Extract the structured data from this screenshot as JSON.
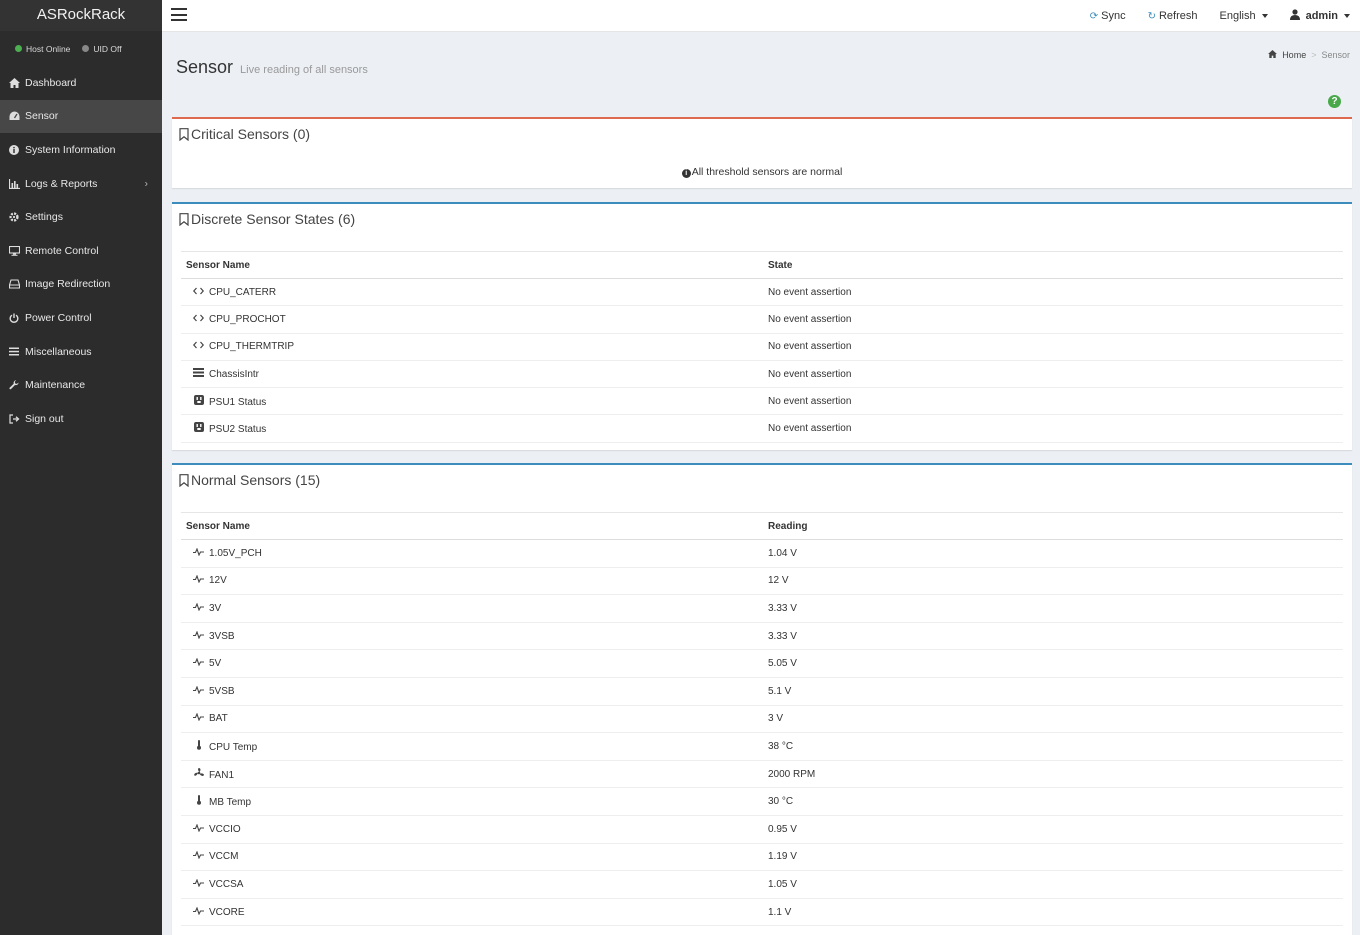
{
  "sidebar": {
    "brand": "ASRockRack",
    "status": [
      {
        "label": "Host Online",
        "color": "#4caf50"
      },
      {
        "label": "UID Off",
        "color": "#888888"
      }
    ],
    "items": [
      {
        "label": "Dashboard",
        "icon": "home-icon"
      },
      {
        "label": "Sensor",
        "icon": "dashboard-icon",
        "active": true
      },
      {
        "label": "System Information",
        "icon": "info-circle-icon"
      },
      {
        "label": "Logs & Reports",
        "icon": "bar-chart-icon"
      },
      {
        "label": "Settings",
        "icon": "gear-icon"
      },
      {
        "label": "Remote Control",
        "icon": "desktop-icon"
      },
      {
        "label": "Image Redirection",
        "icon": "hdd-icon"
      },
      {
        "label": "Power Control",
        "icon": "power-icon"
      },
      {
        "label": "Miscellaneous",
        "icon": "list-icon"
      },
      {
        "label": "Maintenance",
        "icon": "wrench-icon"
      },
      {
        "label": "Sign out",
        "icon": "sign-out-icon"
      }
    ]
  },
  "topbar": {
    "sync_label": "Sync",
    "refresh_label": "Refresh",
    "language_label": "English",
    "user_label": "admin"
  },
  "page": {
    "title": "Sensor",
    "subtitle": "Live reading of all sensors",
    "breadcrumb": {
      "home": "Home",
      "current": "Sensor"
    }
  },
  "critical": {
    "title": "Critical Sensors (0)",
    "message": "All threshold sensors are normal"
  },
  "discrete": {
    "title": "Discrete Sensor States (6)",
    "col_name": "Sensor Name",
    "col_state": "State",
    "rows": [
      {
        "name": "CPU_CATERR",
        "icon": "code-icon",
        "state": "No event assertion"
      },
      {
        "name": "CPU_PROCHOT",
        "icon": "code-icon",
        "state": "No event assertion"
      },
      {
        "name": "CPU_THERMTRIP",
        "icon": "code-icon",
        "state": "No event assertion"
      },
      {
        "name": "ChassisIntr",
        "icon": "server-icon",
        "state": "No event assertion"
      },
      {
        "name": "PSU1 Status",
        "icon": "plug-icon",
        "state": "No event assertion"
      },
      {
        "name": "PSU2 Status",
        "icon": "plug-icon",
        "state": "No event assertion"
      }
    ]
  },
  "normal": {
    "title": "Normal Sensors (15)",
    "col_name": "Sensor Name",
    "col_reading": "Reading",
    "rows": [
      {
        "name": "1.05V_PCH",
        "icon": "pulse-icon",
        "reading": "1.04 V"
      },
      {
        "name": "12V",
        "icon": "pulse-icon",
        "reading": "12 V"
      },
      {
        "name": "3V",
        "icon": "pulse-icon",
        "reading": "3.33 V"
      },
      {
        "name": "3VSB",
        "icon": "pulse-icon",
        "reading": "3.33 V"
      },
      {
        "name": "5V",
        "icon": "pulse-icon",
        "reading": "5.05 V"
      },
      {
        "name": "5VSB",
        "icon": "pulse-icon",
        "reading": "5.1 V"
      },
      {
        "name": "BAT",
        "icon": "pulse-icon",
        "reading": "3 V"
      },
      {
        "name": "CPU Temp",
        "icon": "thermometer-icon",
        "reading": "38 °C"
      },
      {
        "name": "FAN1",
        "icon": "fan-icon",
        "reading": "2000 RPM"
      },
      {
        "name": "MB Temp",
        "icon": "thermometer-icon",
        "reading": "30 °C"
      },
      {
        "name": "VCCIO",
        "icon": "pulse-icon",
        "reading": "0.95 V"
      },
      {
        "name": "VCCM",
        "icon": "pulse-icon",
        "reading": "1.19 V"
      },
      {
        "name": "VCCSA",
        "icon": "pulse-icon",
        "reading": "1.05 V"
      },
      {
        "name": "VCORE",
        "icon": "pulse-icon",
        "reading": "1.1 V"
      }
    ]
  },
  "colors": {
    "sidebar_bg": "#2c2c2c",
    "accent": "#3c8dbc",
    "critical": "#dd6a4f",
    "help": "#48a84a"
  }
}
